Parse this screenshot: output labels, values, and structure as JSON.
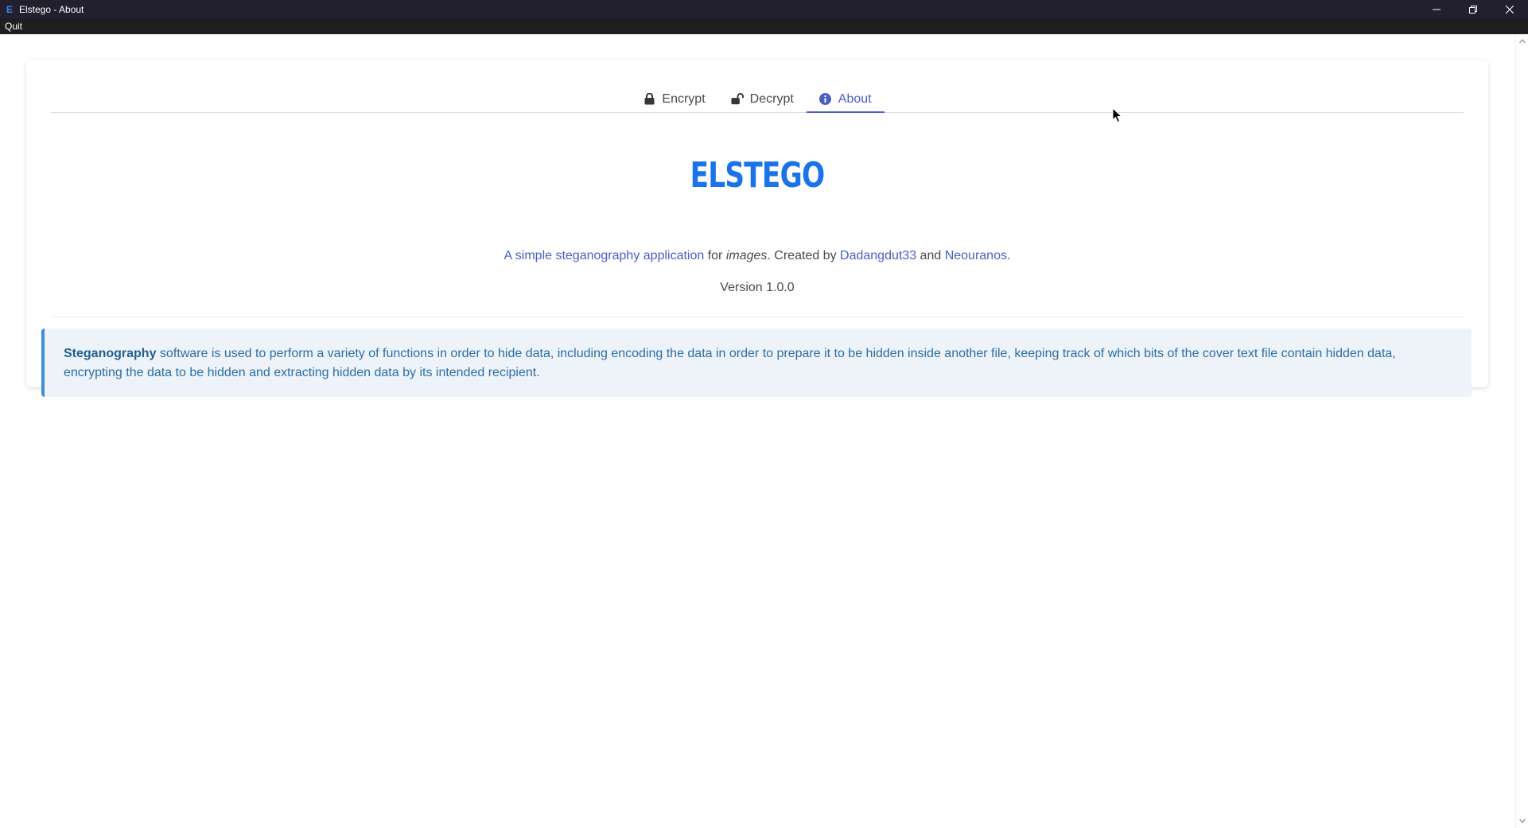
{
  "window": {
    "app_glyph": "E",
    "title": "Elstego - About",
    "controls": [
      "minimize-icon",
      "restore-icon",
      "close-icon"
    ]
  },
  "menu": {
    "items": [
      "Quit"
    ]
  },
  "tabs": [
    {
      "label": "Encrypt",
      "icon": "lock-icon",
      "active": false
    },
    {
      "label": "Decrypt",
      "icon": "unlock-icon",
      "active": false
    },
    {
      "label": "About",
      "icon": "info-icon",
      "active": true
    }
  ],
  "about": {
    "heading": "ELSTEGO",
    "subtitle": {
      "link1": "A simple steganography application",
      "text1": " for ",
      "italic": "images",
      "text2": ". Created by ",
      "link2": "Dadangdut33",
      "text3": " and ",
      "link3": "Neouranos",
      "text4": "."
    },
    "version": "Version 1.0.0",
    "notice": {
      "bold": "Steganography",
      "text": " software is used to perform a variety of functions in order to hide data, including encoding the data in order to prepare it to be hidden inside another file, keeping track of which bits of the cover text file contain hidden data, encrypting the data to be hidden and extracting hidden data by its intended recipient."
    }
  },
  "colors": {
    "titlebar": "#221f2f",
    "menubar": "#1e1e1e",
    "accent": "#485fc7",
    "heading": "#1a73e8",
    "notice_bg": "#eef3fa",
    "notice_border": "#3e8ed0"
  }
}
